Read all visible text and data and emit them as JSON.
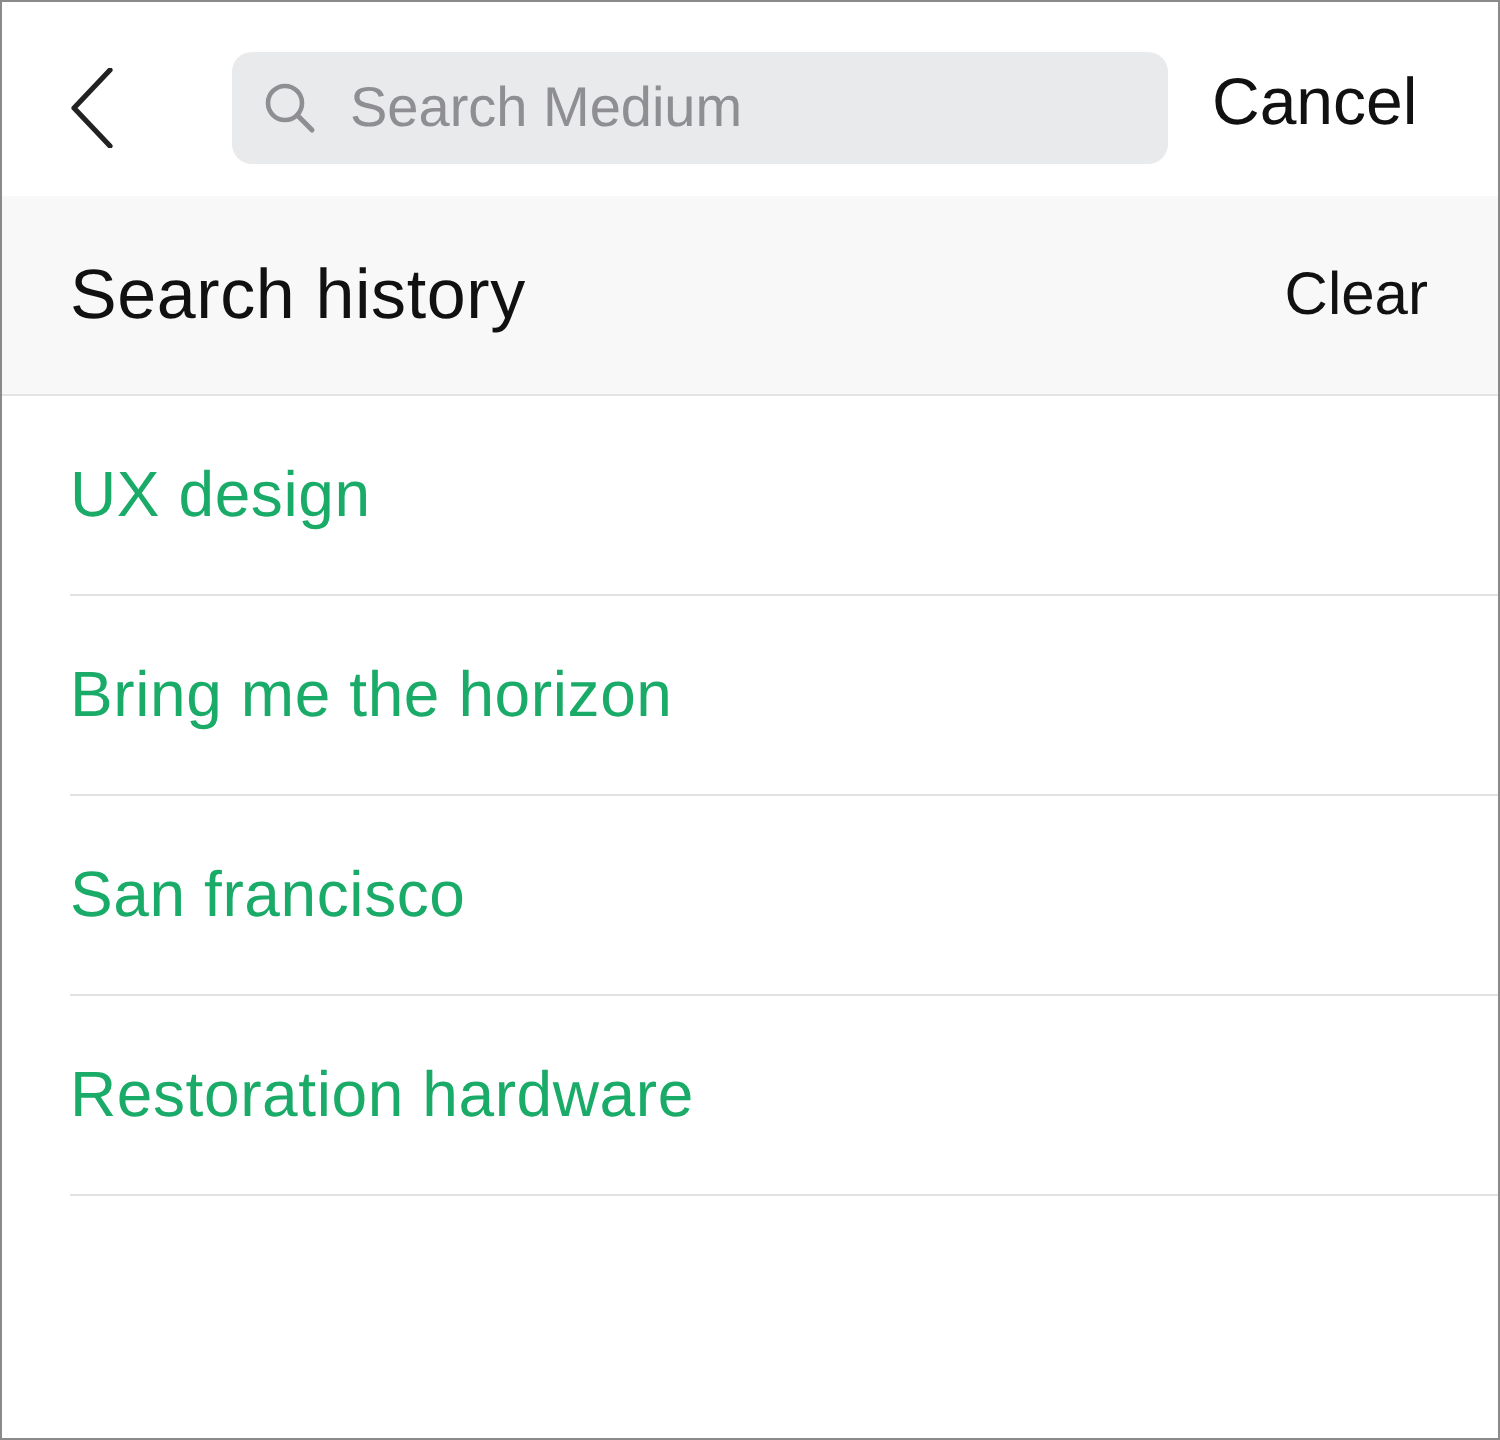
{
  "top_bar": {
    "search": {
      "placeholder": "Search Medium"
    },
    "cancel": "Cancel"
  },
  "history": {
    "title": "Search history",
    "clear": "Clear",
    "items": [
      {
        "label": "UX design"
      },
      {
        "label": "Bring me the horizon"
      },
      {
        "label": "San francisco"
      },
      {
        "label": "Restoration hardware"
      }
    ]
  }
}
